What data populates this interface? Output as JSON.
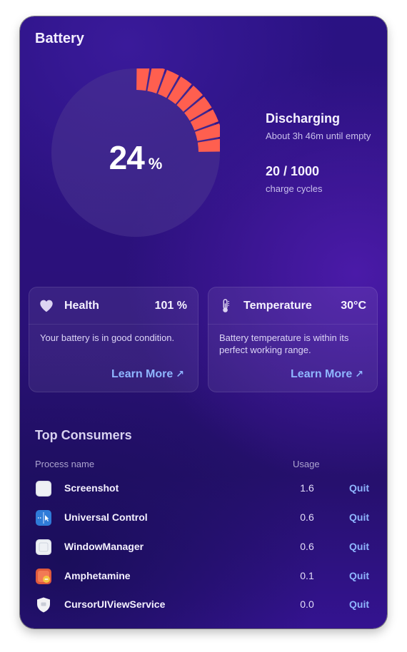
{
  "header": {
    "title": "Battery"
  },
  "gauge": {
    "percent_value": "24",
    "percent_unit": "%",
    "level": 0.24
  },
  "status": {
    "state": "Discharging",
    "time_remaining": "About 3h 46m until empty",
    "cycles_value": "20 / 1000",
    "cycles_label": "charge cycles"
  },
  "health": {
    "title": "Health",
    "value": "101 %",
    "description": "Your battery is in good condition.",
    "link": "Learn More"
  },
  "temperature": {
    "title": "Temperature",
    "value": "30°C",
    "description": "Battery temperature is within its perfect working range.",
    "link": "Learn More"
  },
  "consumers": {
    "title": "Top Consumers",
    "col_process": "Process name",
    "col_usage": "Usage",
    "quit_label": "Quit",
    "rows": [
      {
        "name": "Screenshot",
        "usage": "1.6",
        "icon": "screenshot-icon"
      },
      {
        "name": "Universal Control",
        "usage": "0.6",
        "icon": "universal-control-icon"
      },
      {
        "name": "WindowManager",
        "usage": "0.6",
        "icon": "window-manager-icon"
      },
      {
        "name": "Amphetamine",
        "usage": "0.1",
        "icon": "amphetamine-icon"
      },
      {
        "name": "CursorUIViewService",
        "usage": "0.0",
        "icon": "shield-icon"
      }
    ]
  },
  "colors": {
    "accent_link": "#8fb6ff",
    "gauge_fill": "#ff5f4f",
    "gauge_track": "#4b3590"
  }
}
